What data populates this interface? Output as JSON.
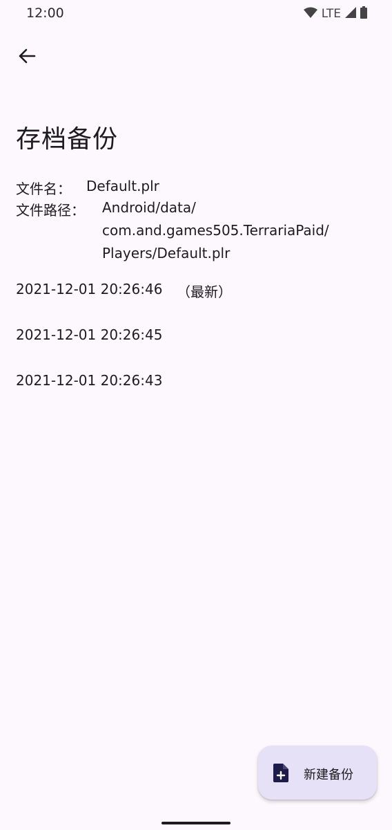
{
  "status_bar": {
    "time": "12:00",
    "network": "LTE",
    "icons": [
      "wifi-icon",
      "signal-icon",
      "battery-icon"
    ]
  },
  "toolbar": {
    "back_icon": "arrow-back-icon"
  },
  "page": {
    "title": "存档备份",
    "file_name_label": "文件名：",
    "file_name_value": "Default.plr",
    "file_path_label": "文件路径：",
    "file_path_lines": [
      "Android/data/",
      "com.and.games505.TerrariaPaid/",
      "Players/Default.plr"
    ]
  },
  "backups": [
    {
      "time": "2021-12-01 20:26:46",
      "tag": "（最新）"
    },
    {
      "time": "2021-12-01 20:26:45",
      "tag": ""
    },
    {
      "time": "2021-12-01 20:26:43",
      "tag": ""
    }
  ],
  "fab": {
    "label": "新建备份",
    "icon": "add-file-icon"
  },
  "colors": {
    "background": "#fdf8fd",
    "fab_background": "#e6e1f6",
    "icon_dark": "#1c1b4a"
  }
}
